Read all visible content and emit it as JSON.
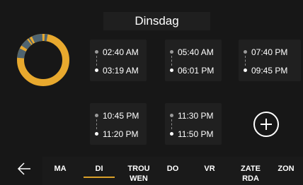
{
  "header": {
    "day_title": "Dinsdag"
  },
  "colors": {
    "accent": "#E8A92E",
    "inactive_segment": "#4F6470",
    "card": "#202020",
    "background": "#171717"
  },
  "schedule_ring": {
    "segments_note_icon": "day-schedule-ring-icon"
  },
  "time_slots": [
    {
      "start": "02:40 AM",
      "end": "03:19 AM"
    },
    {
      "start": "05:40 AM",
      "end": "06:01 PM"
    },
    {
      "start": "07:40 PM",
      "end": "09:45 PM"
    },
    {
      "start": "10:45 PM",
      "end": "11:20 PM"
    },
    {
      "start": "11:30 PM",
      "end": "11:50 PM"
    }
  ],
  "actions": {
    "add_icon": "plus-circle-icon",
    "back_icon": "arrow-left-icon"
  },
  "day_tabs": [
    {
      "label": "MA",
      "selected": false
    },
    {
      "label": "DI",
      "selected": true
    },
    {
      "label": "TROU WEN",
      "selected": false
    },
    {
      "label": "DO",
      "selected": false
    },
    {
      "label": "VR",
      "selected": false
    },
    {
      "label": "ZATE RDA",
      "selected": false
    },
    {
      "label": "ZON",
      "selected": false
    }
  ]
}
